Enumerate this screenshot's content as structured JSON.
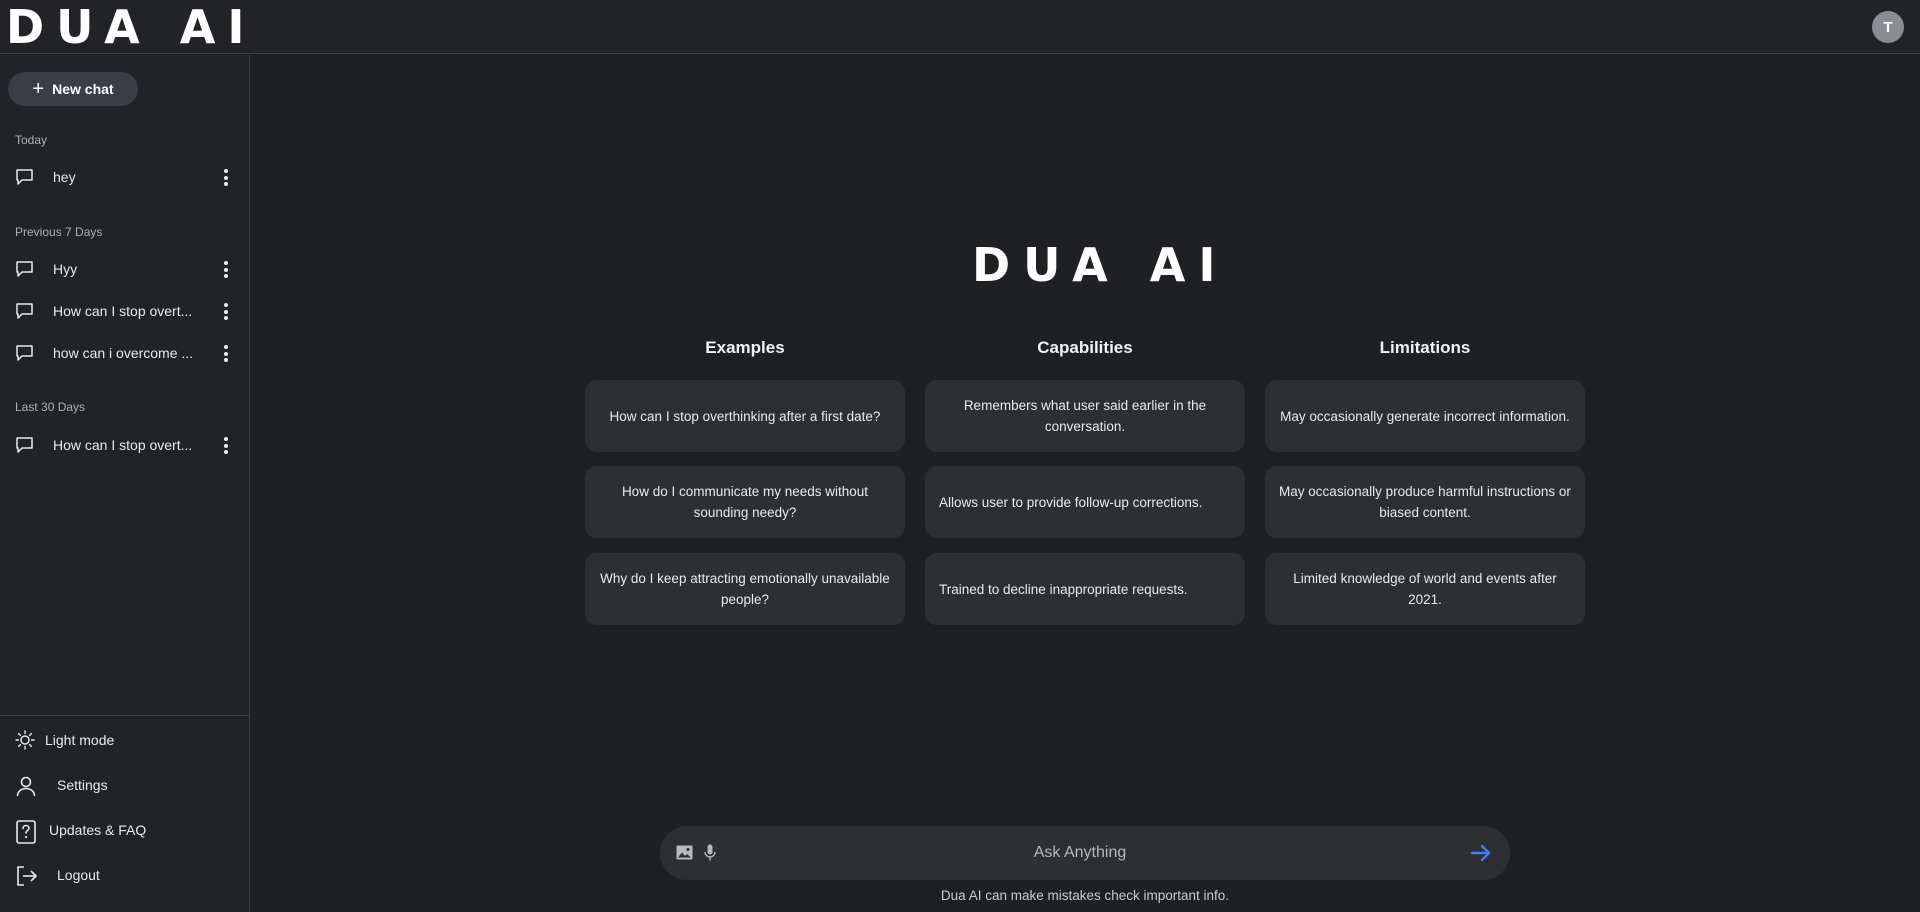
{
  "header": {
    "logo": "DUA AI",
    "avatar_initial": "T"
  },
  "sidebar": {
    "new_chat_label": "New chat",
    "sections": [
      {
        "label": "Today",
        "items": [
          "hey"
        ]
      },
      {
        "label": "Previous 7 Days",
        "items": [
          "Hyy",
          "How can I stop overt...",
          "how can i overcome ..."
        ]
      },
      {
        "label": "Last 30 Days",
        "items": [
          "How can I stop overt..."
        ]
      }
    ],
    "bottom": {
      "light_mode": "Light mode",
      "settings": "Settings",
      "updates": "Updates & FAQ",
      "logout": "Logout"
    }
  },
  "main": {
    "logo": "DUA AI",
    "columns": [
      {
        "heading": "Examples",
        "cards": [
          "How can I stop overthinking after a first date?",
          "How do I communicate my needs without sounding needy?",
          "Why do I keep attracting emotionally unavailable people?"
        ]
      },
      {
        "heading": "Capabilities",
        "cards": [
          "Remembers what user said earlier in the conversation.",
          "Allows user to provide follow-up corrections.",
          "Trained to decline inappropriate requests."
        ]
      },
      {
        "heading": "Limitations",
        "cards": [
          "May occasionally generate incorrect information.",
          "May occasionally produce harmful instructions or biased content.",
          "Limited knowledge of world and events after 2021."
        ]
      }
    ],
    "input": {
      "placeholder": "Ask Anything",
      "value": ""
    },
    "disclaimer": "Dua AI can make mistakes check important info."
  },
  "colors": {
    "background": "#1e2024",
    "sidebar": "#212327",
    "card": "#2d2f33",
    "accent": "#3b82f6"
  },
  "icons": {
    "chat": "chat-bubble-icon",
    "more": "more-vertical-icon",
    "plus": "plus-icon",
    "sun": "sun-icon",
    "user": "user-icon",
    "help": "help-icon",
    "logout": "logout-icon",
    "image": "image-icon",
    "mic": "mic-icon",
    "send": "send-arrow-icon"
  }
}
